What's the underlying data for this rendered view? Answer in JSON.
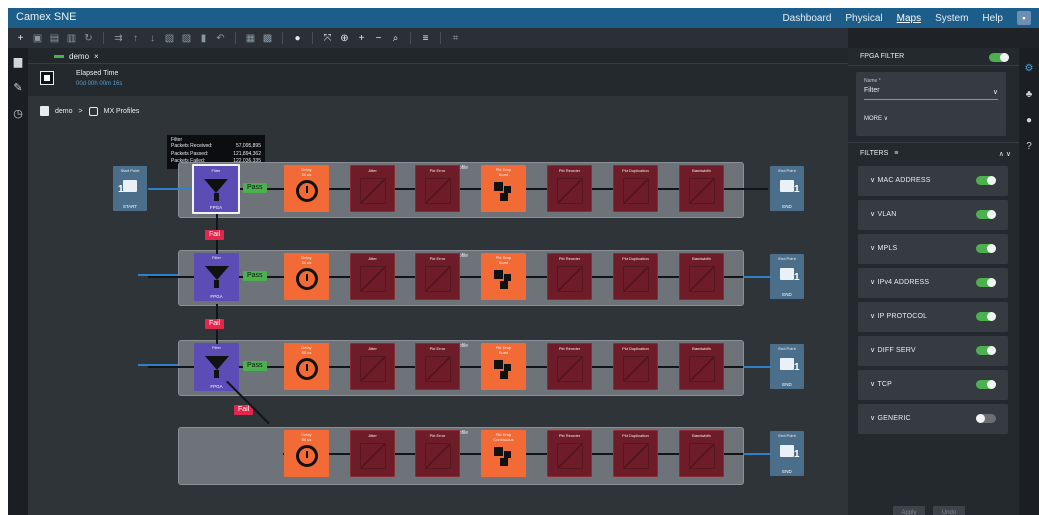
{
  "app": {
    "brand": "Camex SNE"
  },
  "nav": {
    "items": [
      "Dashboard",
      "Physical",
      "Maps",
      "System",
      "Help"
    ],
    "active": "Maps"
  },
  "tab": {
    "label": "demo",
    "close": "×"
  },
  "elapsed": {
    "label": "Elapsed Time",
    "value": "00d 00h 00m 16s"
  },
  "breadcrumb": {
    "root": "demo",
    "separator": ">",
    "leaf": "MX Profiles"
  },
  "tooltip": {
    "title": "Filter",
    "rows": [
      {
        "label": "Packets Received:",
        "value": "57,095,895"
      },
      {
        "label": "Packets Passed:",
        "value": "121,894,362"
      },
      {
        "label": "Packets Failed:",
        "value": "122,036,335"
      }
    ]
  },
  "diagram": {
    "profile_title": "Profile",
    "start": {
      "title": "Start Point",
      "num": "1",
      "sub": "START"
    },
    "end": {
      "title": "End Point",
      "num": "1",
      "sub": "END"
    },
    "filter": {
      "title": "Filter",
      "sub": "FPGA"
    },
    "delay": {
      "title": "Delay\n50 us"
    },
    "jitter": {
      "title": "Jitter"
    },
    "pkt_error": {
      "title": "Pkt Error"
    },
    "pkt_drop_burst": {
      "title": "Pkt Drop\nBurst"
    },
    "pkt_drop_cont": {
      "title": "Pkt Drop\nContinuous"
    },
    "pkt_reorder": {
      "title": "Pkt Reorder"
    },
    "pkt_dup": {
      "title": "Pkt Duplication"
    },
    "bandwidth": {
      "title": "Bandwidth"
    },
    "pass": "Pass",
    "fail": "Fail"
  },
  "panel": {
    "fpga_filter": "FPGA FILTER",
    "name_label": "Name *",
    "name_value": "Filter",
    "more": "MORE ∨",
    "filters_label": "FILTERS",
    "items": [
      {
        "label": "∨  MAC ADDRESS",
        "on": true
      },
      {
        "label": "∨  VLAN",
        "on": true
      },
      {
        "label": "∨  MPLS",
        "on": true
      },
      {
        "label": "∨  IPv4 ADDRESS",
        "on": true
      },
      {
        "label": "∨  IP PROTOCOL",
        "on": true
      },
      {
        "label": "∨  DIFF SERV",
        "on": true
      },
      {
        "label": "∨  TCP",
        "on": true
      },
      {
        "label": "∨  GENERIC",
        "on": false
      }
    ],
    "apply": "Apply",
    "undo": "Undo"
  }
}
